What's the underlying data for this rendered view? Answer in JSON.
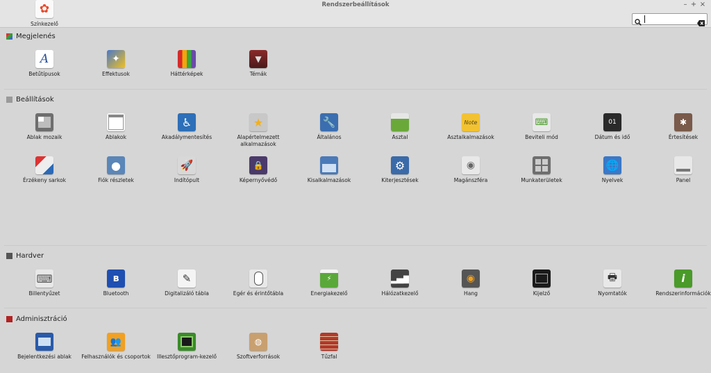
{
  "window": {
    "title": "Rendszerbeállítások",
    "minimize": "–",
    "maximize": "+",
    "close": "×"
  },
  "search": {
    "value": "",
    "placeholder": ""
  },
  "sections": [
    {
      "title": "Megjelenés",
      "color": "#6a5acd",
      "items": [
        {
          "label": "Betűtípusok",
          "icon": "font-icon"
        },
        {
          "label": "Effektusok",
          "icon": "effects-icon"
        },
        {
          "label": "Háttérképek",
          "icon": "wallpaper-icon"
        },
        {
          "label": "Témák",
          "icon": "themes-icon"
        }
      ]
    },
    {
      "title": "Beállítások",
      "color": "#9a9a9a",
      "items": [
        {
          "label": "Ablak mozaik",
          "icon": "window-tiling-icon"
        },
        {
          "label": "Ablakok",
          "icon": "windows-icon"
        },
        {
          "label": "Akadálymentesítés",
          "icon": "accessibility-icon"
        },
        {
          "label": "Alapértelmezett alkalmazások",
          "icon": "default-apps-icon"
        },
        {
          "label": "Általános",
          "icon": "general-icon"
        },
        {
          "label": "Asztal",
          "icon": "desktop-icon"
        },
        {
          "label": "Asztalkalmazások",
          "icon": "desklets-icon"
        },
        {
          "label": "Beviteli mód",
          "icon": "input-method-icon"
        },
        {
          "label": "Dátum és idő",
          "icon": "date-time-icon"
        },
        {
          "label": "Értesítések",
          "icon": "notifications-icon"
        },
        {
          "label": "Érzékeny sarkok",
          "icon": "hot-corners-icon"
        },
        {
          "label": "Fiók részletek",
          "icon": "account-icon"
        },
        {
          "label": "Indítópult",
          "icon": "startup-icon"
        },
        {
          "label": "Képernyővédő",
          "icon": "screensaver-icon"
        },
        {
          "label": "Kisalkalmazások",
          "icon": "applets-icon"
        },
        {
          "label": "Kiterjesztések",
          "icon": "extensions-icon"
        },
        {
          "label": "Magánszféra",
          "icon": "privacy-icon"
        },
        {
          "label": "Munkaterületek",
          "icon": "workspaces-icon"
        },
        {
          "label": "Nyelvek",
          "icon": "languages-icon"
        },
        {
          "label": "Panel",
          "icon": "panel-icon"
        }
      ]
    },
    {
      "title": "Hardver",
      "color": "#555555",
      "items": [
        {
          "label": "Billentyűzet",
          "icon": "keyboard-icon"
        },
        {
          "label": "Bluetooth",
          "icon": "bluetooth-icon"
        },
        {
          "label": "Digitalizáló tábla",
          "icon": "tablet-icon"
        },
        {
          "label": "Egér és érintőtábla",
          "icon": "mouse-icon"
        },
        {
          "label": "Energiakezelő",
          "icon": "power-icon"
        },
        {
          "label": "Hálózatkezelő",
          "icon": "network-icon"
        },
        {
          "label": "Hang",
          "icon": "sound-icon"
        },
        {
          "label": "Kijelző",
          "icon": "display-icon"
        },
        {
          "label": "Nyomtatók",
          "icon": "printer-icon"
        },
        {
          "label": "Rendszerinformációk",
          "icon": "system-info-icon"
        },
        {
          "label": "Színkezelő",
          "icon": "color-icon"
        }
      ]
    },
    {
      "title": "Adminisztráció",
      "color": "#b22222",
      "items": [
        {
          "label": "Bejelentkezési ablak",
          "icon": "login-window-icon"
        },
        {
          "label": "Felhasználók és csoportok",
          "icon": "users-groups-icon"
        },
        {
          "label": "Illesztőprogram-kezelő",
          "icon": "driver-manager-icon"
        },
        {
          "label": "Szoftverforrások",
          "icon": "software-sources-icon"
        },
        {
          "label": "Tűzfal",
          "icon": "firewall-icon"
        }
      ]
    }
  ]
}
